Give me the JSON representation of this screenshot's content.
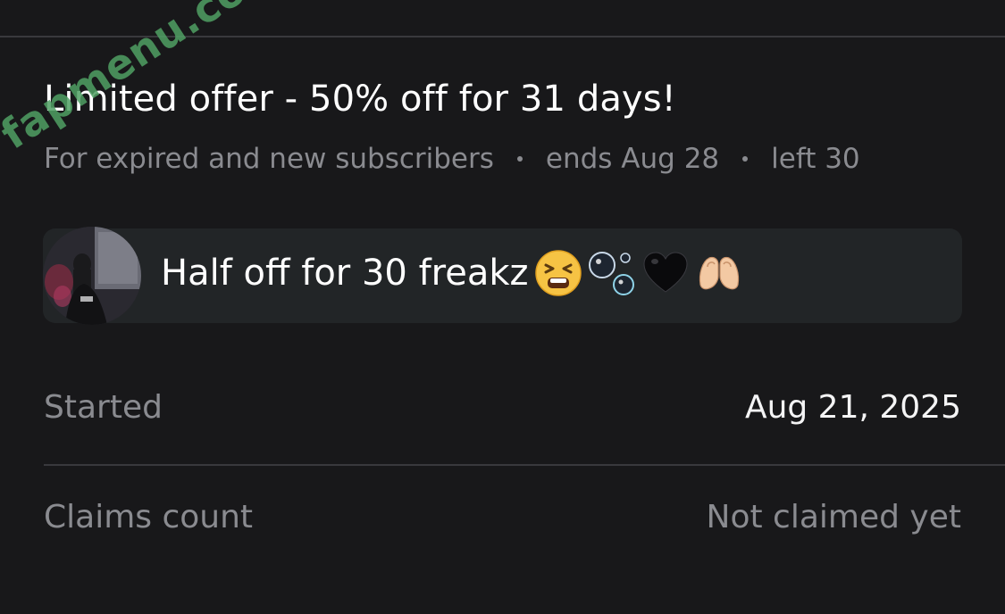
{
  "offer": {
    "title": "Limited offer - 50% off for 31 days!",
    "audience": "For expired and new subscribers",
    "ends": "ends Aug 28",
    "left": "left 30"
  },
  "watermark": "fapmenu.com",
  "message": {
    "text": "Half off for 30 freakz",
    "emojis": [
      "tired-face-emoji",
      "bubbles-emoji",
      "black-heart-emoji",
      "heart-hands-emoji"
    ]
  },
  "details": {
    "started_label": "Started",
    "started_value": "Aug 21, 2025",
    "claims_label": "Claims count",
    "claims_value": "Not claimed yet"
  },
  "colors": {
    "background": "#18181a",
    "message_box": "#222527",
    "muted_text": "#8a8b90",
    "primary_text": "#f4f4f5",
    "divider": "#39393d",
    "watermark": "#50a064"
  }
}
